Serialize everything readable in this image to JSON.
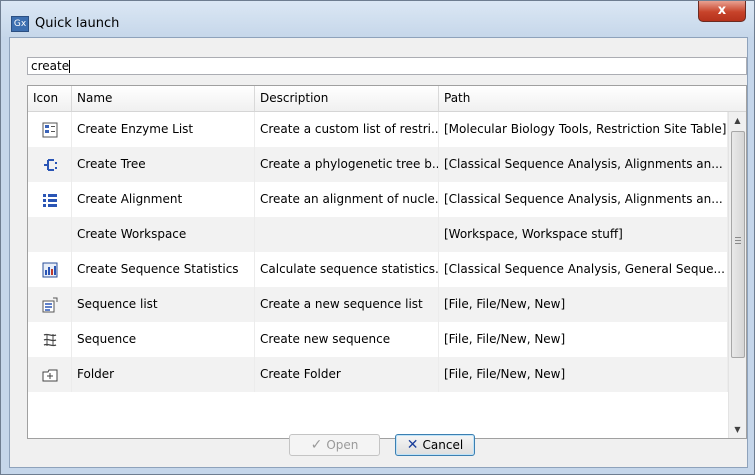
{
  "window": {
    "title": "Quick launch",
    "app_icon": "Gx",
    "close_label": "x"
  },
  "search": {
    "value": "create"
  },
  "columns": [
    "Icon",
    "Name",
    "Description",
    "Path"
  ],
  "rows": [
    {
      "icon": "enzyme-list-icon",
      "name": "Create Enzyme List",
      "description": "Create a custom list of restri...",
      "path": "[Molecular Biology Tools, Restriction Site Table]"
    },
    {
      "icon": "tree-icon",
      "name": "Create Tree",
      "description": "Create a phylogenetic tree b...",
      "path": "[Classical Sequence Analysis, Alignments an..."
    },
    {
      "icon": "alignment-icon",
      "name": "Create Alignment",
      "description": "Create an alignment of nucle...",
      "path": "[Classical Sequence Analysis, Alignments an..."
    },
    {
      "icon": "",
      "name": "Create Workspace",
      "description": "",
      "path": "[Workspace, Workspace stuff]"
    },
    {
      "icon": "statistics-icon",
      "name": "Create Sequence Statistics",
      "description": "Calculate sequence statistics...",
      "path": "[Classical Sequence Analysis, General Seque..."
    },
    {
      "icon": "sequence-list-icon",
      "name": "Sequence list",
      "description": "Create a new sequence list",
      "path": "[File, File/New, New]"
    },
    {
      "icon": "sequence-icon",
      "name": "Sequence",
      "description": "Create new sequence",
      "path": "[File, File/New, New]"
    },
    {
      "icon": "folder-icon",
      "name": "Folder",
      "description": "Create Folder",
      "path": "[File, File/New, New]"
    }
  ],
  "buttons": {
    "open_label": "Open",
    "cancel_label": "Cancel"
  },
  "colors": {
    "title_bar": "#c6d7ea",
    "close_button": "#c7432a",
    "alt_row": "#f2f2f2"
  }
}
